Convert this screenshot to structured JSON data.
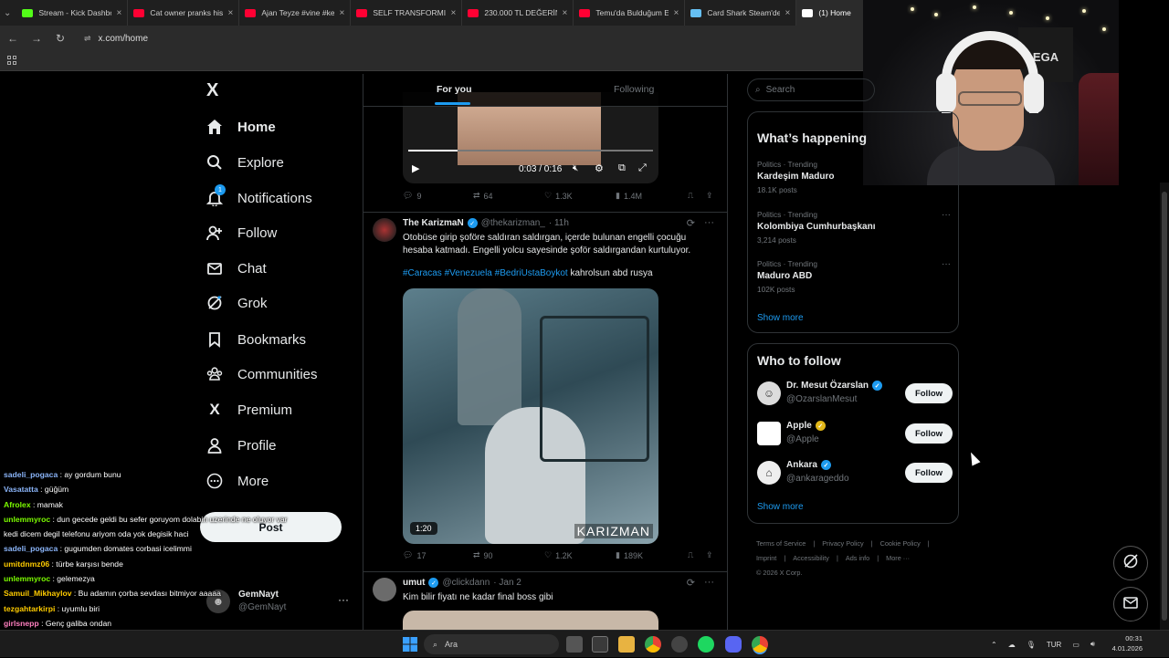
{
  "browser": {
    "tabs": [
      {
        "label": "Stream - Kick Dashbo",
        "color": "#53fc18"
      },
      {
        "label": "Cat owner pranks his",
        "color": "#ff0033"
      },
      {
        "label": "Ajan Teyze #vine #ke",
        "color": "#ff0033"
      },
      {
        "label": "SELF TRANSFORMIN",
        "color": "#ff0033"
      },
      {
        "label": "230.000 TL DEĞERİN",
        "color": "#ff0033"
      },
      {
        "label": "Temu'da Bulduğum E",
        "color": "#ff0033"
      },
      {
        "label": "Card Shark Steam'de",
        "color": "#66c0f4"
      },
      {
        "label": "(1) Home",
        "color": "#ffffff"
      }
    ],
    "url": "x.com/home"
  },
  "nav": {
    "logo": "X",
    "items": [
      {
        "label": "Home",
        "icon": "home-icon"
      },
      {
        "label": "Explore",
        "icon": "search-icon"
      },
      {
        "label": "Notifications",
        "icon": "bell-icon",
        "badge": "1"
      },
      {
        "label": "Follow",
        "icon": "person-add-icon"
      },
      {
        "label": "Chat",
        "icon": "envelope-icon"
      },
      {
        "label": "Grok",
        "icon": "grok-icon"
      },
      {
        "label": "Bookmarks",
        "icon": "bookmark-icon"
      },
      {
        "label": "Communities",
        "icon": "people-icon"
      },
      {
        "label": "Premium",
        "icon": "x-icon"
      },
      {
        "label": "Profile",
        "icon": "person-icon"
      },
      {
        "label": "More",
        "icon": "more-circle-icon"
      }
    ],
    "post_label": "Post",
    "account": {
      "name": "GemNayt",
      "handle": "@GemNayt"
    }
  },
  "chat": [
    {
      "user": "sadeli_pogaca",
      "color": "#8ab4f8",
      "text": " : ay gordum bunu"
    },
    {
      "user": "Vasatatta",
      "color": "#8ab4f8",
      "text": " : güğüm"
    },
    {
      "user": "Afrolex",
      "color": "#7cfc00",
      "text": " : mamak"
    },
    {
      "user": "unlemmyroc",
      "color": "#7cfc00",
      "text": " : dun gecede geldi bu sefer goruyom dolabin uzerinde ne oluyor var"
    },
    {
      "user": "",
      "color": "#ffffff",
      "text": "kedi dicem degil telefonu ariyom oda yok degisik haci"
    },
    {
      "user": "sadeli_pogaca",
      "color": "#8ab4f8",
      "text": " : gugumden domates corbasi icelimmi"
    },
    {
      "user": "umitdnmz06",
      "color": "#ffcc00",
      "text": " : türbe karşısı bende"
    },
    {
      "user": "unlemmyroc",
      "color": "#7cfc00",
      "text": " : gelemezya"
    },
    {
      "user": "Samuil_Mikhaylov",
      "color": "#ffcc00",
      "text": " : Bu adamın çorba sevdası bitmiyor aaaaa"
    },
    {
      "user": "tezgahtarkirpi",
      "color": "#ffcc00",
      "text": " : uyumlu biri"
    },
    {
      "user": "girlsnepp",
      "color": "#ff7fbf",
      "text": " : Genç galiba ondan"
    },
    {
      "user": "Vasatatta",
      "color": "#8ab4f8",
      "text": " : güğümden tteaokboki yiyonuz mu"
    }
  ],
  "feed": {
    "tabs": {
      "for_you": "For you",
      "following": "Following"
    },
    "top_video": {
      "time": "0:03 / 0:16"
    },
    "top_stats": {
      "replies": "9",
      "reposts": "64",
      "likes": "1.3K",
      "views": "1.4M"
    },
    "post1": {
      "name": "The KarizmaN",
      "handle": "@thekarizman_",
      "time": "· 11h",
      "text": "Otobüse girip şoföre saldıran saldırgan, içerde bulunan engelli çocuğu hesaba katmadı. Engelli yolcu sayesinde şoför saldırgandan kurtuluyor.",
      "tags": [
        "#Caracas",
        "#Venezuela",
        "#BedriUstaBoykot"
      ],
      "tail": " kahrolsun abd rusya",
      "duration": "1:20",
      "watermark": "KARIZMAN",
      "stats": {
        "replies": "17",
        "reposts": "90",
        "likes": "1.2K",
        "views": "189K"
      }
    },
    "post2": {
      "name": "umut",
      "handle": "@clickdann",
      "time": "· Jan 2",
      "text": "Kim bilir fiyatı ne kadar final boss gibi"
    }
  },
  "right": {
    "search_placeholder": "Search",
    "happening_title": "What’s happening",
    "trends": [
      {
        "context": "Politics · Trending",
        "title": "Kardeşim Maduro",
        "posts": "18.1K posts"
      },
      {
        "context": "Politics · Trending",
        "title": "Kolombiya Cumhurbaşkanı",
        "posts": "3,214 posts"
      },
      {
        "context": "Politics · Trending",
        "title": "Maduro ABD",
        "posts": "102K posts"
      }
    ],
    "show_more": "Show more",
    "wtf_title": "Who to follow",
    "wtf": [
      {
        "name": "Dr. Mesut Özarslan",
        "handle": "@OzarslanMesut",
        "badge": "#1d9bf0",
        "follow": "Follow"
      },
      {
        "name": "Apple",
        "handle": "@Apple",
        "badge": "#e2b719",
        "follow": "Follow"
      },
      {
        "name": "Ankara",
        "handle": "@ankarageddo",
        "badge": "#1d9bf0",
        "follow": "Follow"
      }
    ],
    "footer": [
      "Terms of Service",
      "|",
      "Privacy Policy",
      "|",
      "Cookie Policy",
      "|",
      "Imprint",
      "|",
      "Accessibility",
      "|",
      "Ads info",
      "|",
      "More ···",
      "© 2026 X Corp."
    ]
  },
  "taskbar": {
    "search": "Ara",
    "lang": "TUR",
    "time": "00:31",
    "date": "4.01.2026"
  },
  "webcam": {
    "poster_text": "EGA"
  }
}
